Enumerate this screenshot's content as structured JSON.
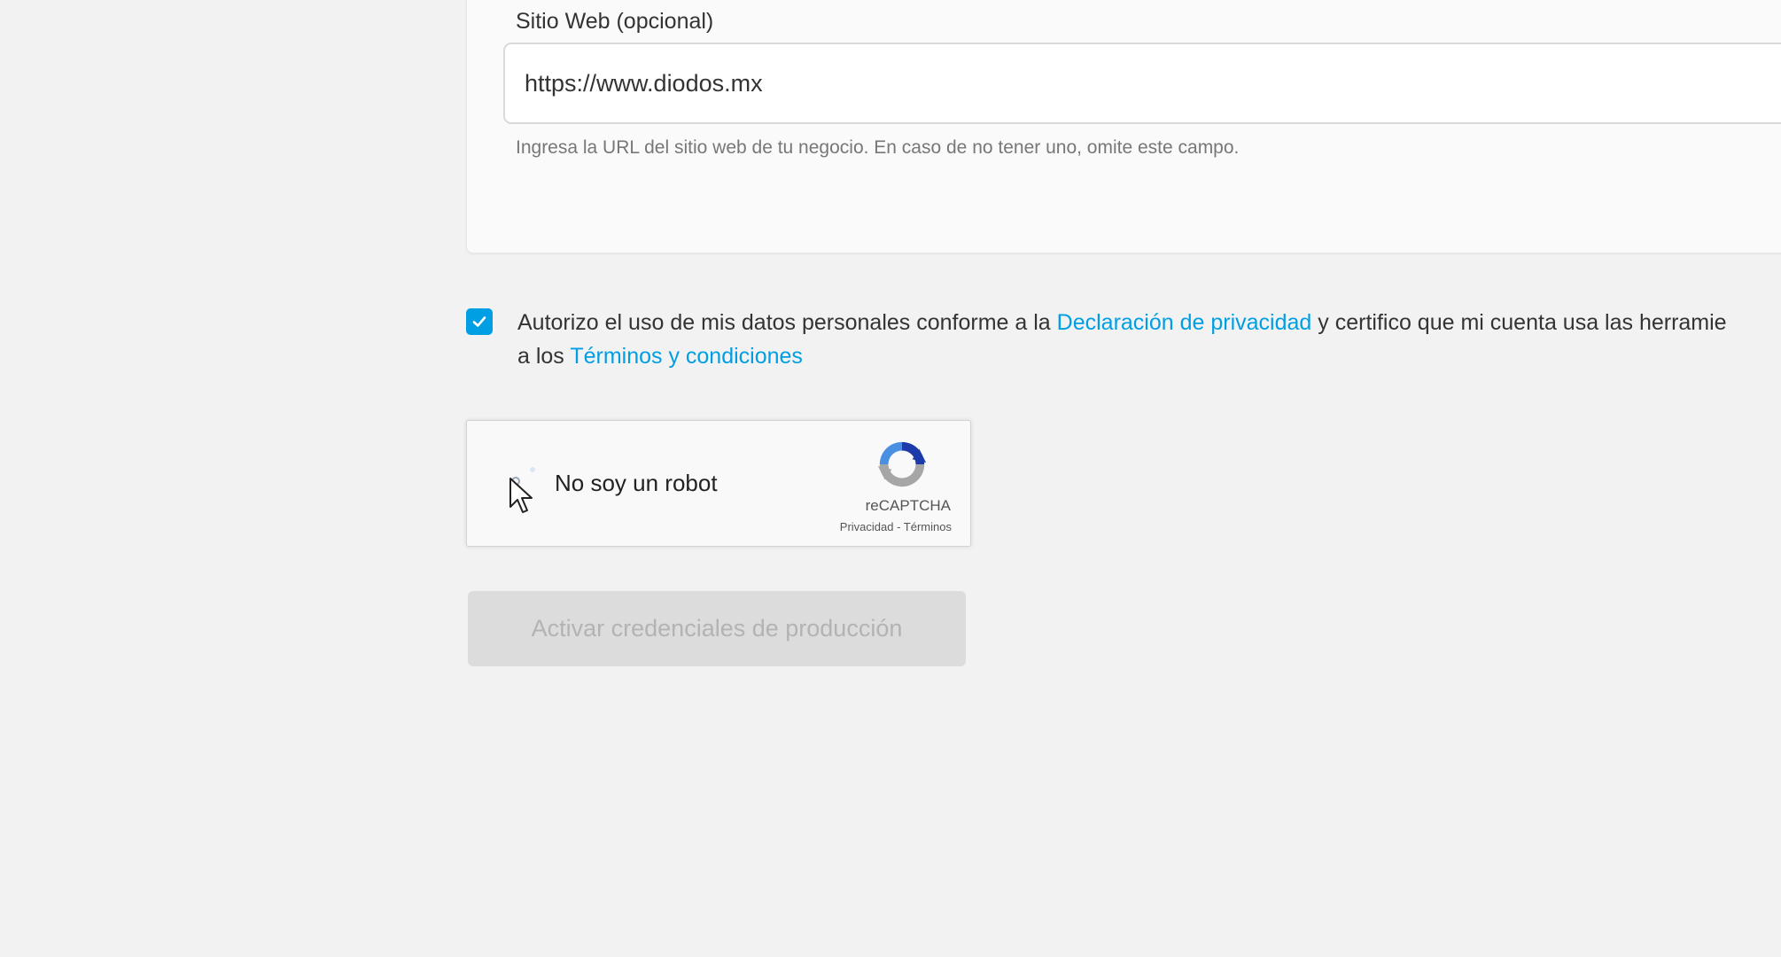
{
  "website_field": {
    "label": "Sitio Web (opcional)",
    "value": "https://www.diodos.mx",
    "help": "Ingresa la URL del sitio web de tu negocio. En caso de no tener uno, omite este campo."
  },
  "consent": {
    "checked": true,
    "text_before": "Autorizo el uso de mis datos personales conforme a la ",
    "privacy_link": "Declaración de privacidad",
    "text_after": " y certifico que mi cuenta usa las herramie",
    "text_line2": "a los ",
    "terms_link": "Términos y condiciones"
  },
  "recaptcha": {
    "label": "No soy un robot",
    "brand": "reCAPTCHA",
    "links": "Privacidad - Términos",
    "logo_icon": "recaptcha-logo-icon"
  },
  "submit": {
    "label": "Activar credenciales de producción",
    "disabled": true
  },
  "colors": {
    "accent": "#009ee3",
    "background": "#f2f2f2",
    "button_disabled_bg": "#dcdcdc",
    "button_disabled_text": "#b3b3b3"
  }
}
